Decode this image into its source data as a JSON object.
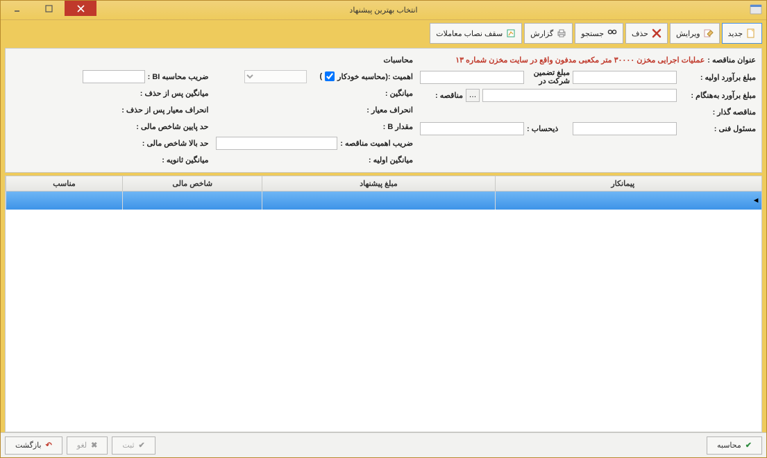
{
  "window": {
    "title": "انتخاب بهترین پیشنهاد"
  },
  "toolbar": {
    "new": "جدید",
    "edit": "ویرایش",
    "delete": "حذف",
    "search": "جستجو",
    "report": "گزارش",
    "ceiling": "سقف نصاب معاملات"
  },
  "form": {
    "tender_title_lbl": "عنوان مناقصه :",
    "tender_title_val": "عملیات اجرایی مخزن ۳۰۰۰۰ متر مکعبی مدفون واقع در سایت مخزن شماره ۱۳",
    "initial_estimate_lbl": "مبلغ برآورد اولیه :",
    "guarantee_lbl_top": "مبلغ تضمین",
    "guarantee_lbl_bottom": "شرکت در",
    "updated_estimate_lbl": "مبلغ برآورد به‌هنگام :",
    "tender_no_lbl": "مناقصه :",
    "tenderer_lbl": "مناقصه گذار :",
    "tech_officer_lbl": "مسئول فنی :",
    "accountant_lbl": "ذیحساب :",
    "calc_heading": "محاسبات",
    "importance_lbl": "اهمیت :(محاسبه  خودکار",
    "bi_coeff_lbl": "ضریب محاسبه BI :",
    "avg_lbl": "میانگین :",
    "avg_after_del_lbl": "میانگین پس از حذف :",
    "std_dev_lbl": "انحراف معیار :",
    "std_dev_after_del_lbl": "انحراف معیار پس از حذف :",
    "b_value_lbl": "مقدار B :",
    "low_fin_idx_lbl": "حد پایین شاخص مالی :",
    "tender_imp_coeff_lbl": "ضریب اهمیت مناقصه :",
    "high_fin_idx_lbl": "حد بالا شاخص مالی :",
    "initial_avg_lbl": "میانگین اولیه :",
    "secondary_avg_lbl": "میانگین ثانویه :",
    "close_paren": ")"
  },
  "grid": {
    "col_contractor": "پیمانکار",
    "col_bid_amount": "مبلغ پیشنهاد",
    "col_fin_idx": "شاخص مالی",
    "col_suitable": "مناسب"
  },
  "footer": {
    "calculate": "محاسبه",
    "save": "ثبت",
    "cancel": "لغو",
    "back": "بازگشت"
  }
}
